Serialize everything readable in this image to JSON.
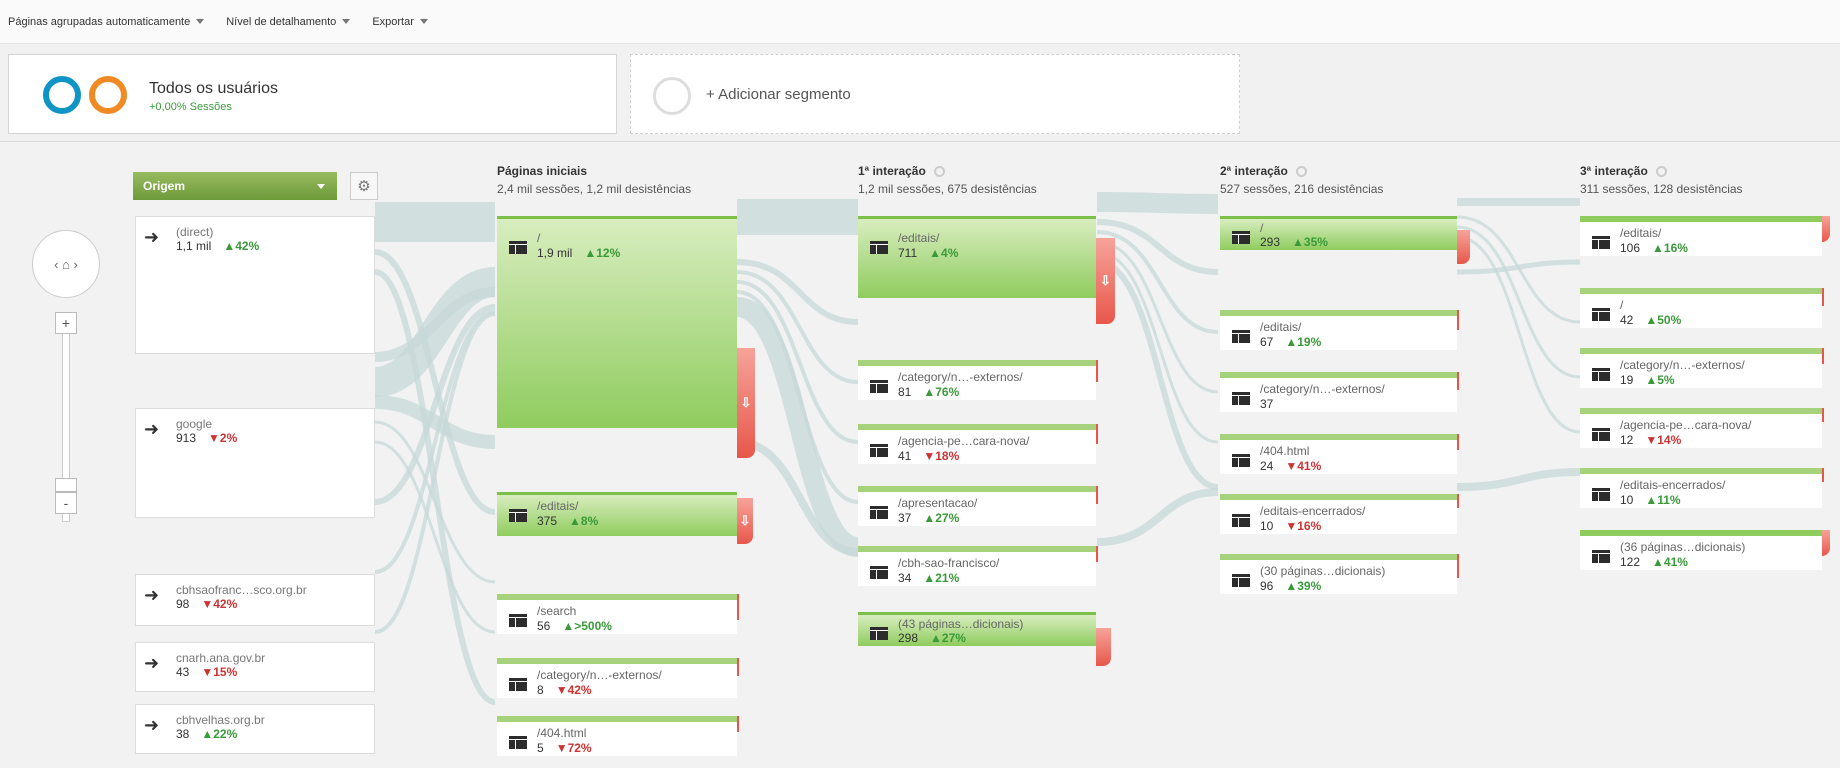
{
  "toolbar": {
    "grouping": "Páginas agrupadas automaticamente",
    "detail": "Nível de detalhamento",
    "export": "Exportar"
  },
  "segments": {
    "all_users_title": "Todos os usuários",
    "all_users_sub": "+0,00% Sessões",
    "add_segment": "+ Adicionar segmento",
    "colors": {
      "ring_blue": "#0f94c6",
      "ring_orange": "#f08a24"
    }
  },
  "controls": {
    "dimension": "Origem",
    "zoom_in": "+",
    "zoom_out": "-"
  },
  "sources": [
    {
      "name": "(direct)",
      "value": "1,1 mil",
      "change": "▲42%",
      "dir": "up"
    },
    {
      "name": "google",
      "value": "913",
      "change": "▼2%",
      "dir": "down"
    },
    {
      "name": "cbhsaofranc…sco.org.br",
      "value": "98",
      "change": "▼42%",
      "dir": "down"
    },
    {
      "name": "cnarh.ana.gov.br",
      "value": "43",
      "change": "▼15%",
      "dir": "down"
    },
    {
      "name": "cbhvelhas.org.br",
      "value": "38",
      "change": "▲22%",
      "dir": "up"
    }
  ],
  "columns": [
    {
      "title": "Páginas iniciais",
      "stats": "2,4 mil sessões, 1,2 mil desistências"
    },
    {
      "title": "1ª interação",
      "stats": "1,2 mil sessões, 675 desistências"
    },
    {
      "title": "2ª interação",
      "stats": "527 sessões, 216 desistências"
    },
    {
      "title": "3ª interação",
      "stats": "311 sessões, 128 desistências"
    }
  ],
  "pages": {
    "col0": [
      {
        "name": "/",
        "value": "1,9 mil",
        "change": "▲12%",
        "dir": "up"
      },
      {
        "name": "/editais/",
        "value": "375",
        "change": "▲8%",
        "dir": "up"
      },
      {
        "name": "/search",
        "value": "56",
        "change": "▲>500%",
        "dir": "up"
      },
      {
        "name": "/category/n…-externos/",
        "value": "8",
        "change": "▼42%",
        "dir": "down"
      },
      {
        "name": "/404.html",
        "value": "5",
        "change": "▼72%",
        "dir": "down"
      }
    ],
    "col1": [
      {
        "name": "/editais/",
        "value": "711",
        "change": "▲4%",
        "dir": "up"
      },
      {
        "name": "/category/n…-externos/",
        "value": "81",
        "change": "▲76%",
        "dir": "up"
      },
      {
        "name": "/agencia-pe…cara-nova/",
        "value": "41",
        "change": "▼18%",
        "dir": "down"
      },
      {
        "name": "/apresentacao/",
        "value": "37",
        "change": "▲27%",
        "dir": "up"
      },
      {
        "name": "/cbh-sao-francisco/",
        "value": "34",
        "change": "▲21%",
        "dir": "up"
      },
      {
        "name": "(43 páginas…dicionais)",
        "value": "298",
        "change": "▲27%",
        "dir": "up"
      }
    ],
    "col2": [
      {
        "name": "/",
        "value": "293",
        "change": "▲35%",
        "dir": "up"
      },
      {
        "name": "/editais/",
        "value": "67",
        "change": "▲19%",
        "dir": "up"
      },
      {
        "name": "/category/n…-externos/",
        "value": "37",
        "change": "",
        "dir": "up"
      },
      {
        "name": "/404.html",
        "value": "24",
        "change": "▼41%",
        "dir": "down"
      },
      {
        "name": "/editais-encerrados/",
        "value": "10",
        "change": "▼16%",
        "dir": "down"
      },
      {
        "name": "(30 páginas…dicionais)",
        "value": "96",
        "change": "▲39%",
        "dir": "up"
      }
    ],
    "col3": [
      {
        "name": "/editais/",
        "value": "106",
        "change": "▲16%",
        "dir": "up"
      },
      {
        "name": "/",
        "value": "42",
        "change": "▲50%",
        "dir": "up"
      },
      {
        "name": "/category/n…-externos/",
        "value": "19",
        "change": "▲5%",
        "dir": "up"
      },
      {
        "name": "/agencia-pe…cara-nova/",
        "value": "12",
        "change": "▼14%",
        "dir": "down"
      },
      {
        "name": "/editais-encerrados/",
        "value": "10",
        "change": "▲11%",
        "dir": "up"
      },
      {
        "name": "(36 páginas…dicionais)",
        "value": "122",
        "change": "▲41%",
        "dir": "up"
      }
    ]
  },
  "dropoff_arrow": "⇩"
}
